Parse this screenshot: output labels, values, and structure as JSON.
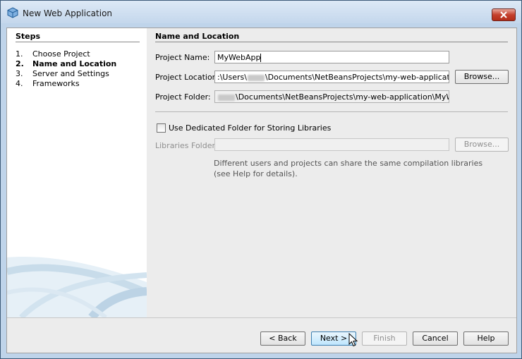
{
  "window": {
    "title": "New Web Application"
  },
  "steps": {
    "heading": "Steps",
    "items": [
      {
        "num": "1.",
        "label": "Choose Project"
      },
      {
        "num": "2.",
        "label": "Name and Location"
      },
      {
        "num": "3.",
        "label": "Server and Settings"
      },
      {
        "num": "4.",
        "label": "Frameworks"
      }
    ],
    "active_index": 1
  },
  "main": {
    "heading": "Name and Location",
    "project_name": {
      "label": "Project Name:",
      "value": "MyWebApp"
    },
    "project_location": {
      "label": "Project Location:",
      "value_prefix": ":\\Users\\",
      "value_suffix": "\\Documents\\NetBeansProjects\\my-web-application",
      "browse_label": "Browse..."
    },
    "project_folder": {
      "label": "Project Folder:",
      "value_suffix": "\\Documents\\NetBeansProjects\\my-web-application\\MyWebApp"
    },
    "dedicated_folder": {
      "label": "Use Dedicated Folder for Storing Libraries",
      "checked": false
    },
    "libraries_folder": {
      "label": "Libraries Folder:",
      "value": "",
      "browse_label": "Browse..."
    },
    "hint_line1": "Different users and projects can share the same compilation libraries",
    "hint_line2": "(see Help for details)."
  },
  "buttons": {
    "back": "< Back",
    "next": "Next >",
    "finish": "Finish",
    "cancel": "Cancel",
    "help": "Help"
  },
  "icons": {
    "window": "netbeans-cube-icon",
    "close": "close-icon",
    "cursor": "mouse-pointer-icon"
  },
  "colors": {
    "title_bar": "#c4d7ec",
    "close_button": "#c5402c",
    "panel": "#ececec"
  }
}
